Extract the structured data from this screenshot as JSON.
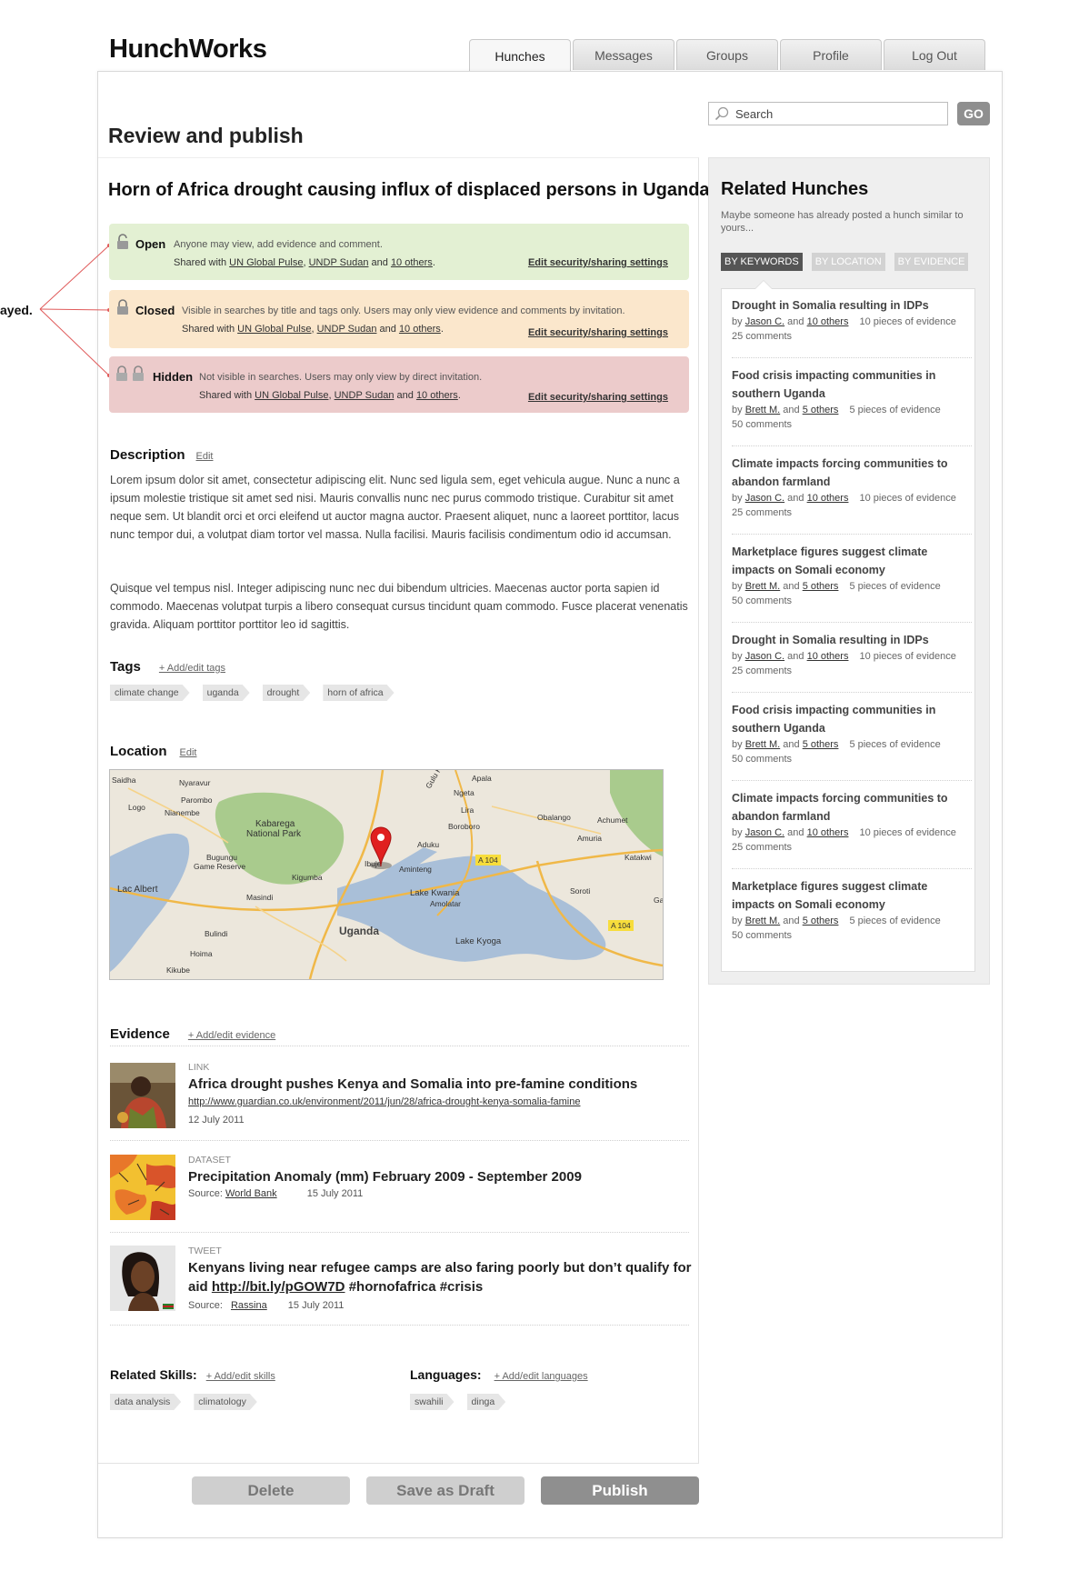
{
  "app": {
    "name": "HunchWorks"
  },
  "nav": {
    "tabs": [
      "Hunches",
      "Messages",
      "Groups",
      "Profile",
      "Log Out"
    ],
    "active": 0
  },
  "annotation": {
    "text": "ayed."
  },
  "search": {
    "placeholder": "Search",
    "go": "GO"
  },
  "page": {
    "title": "Review and publish"
  },
  "hunch": {
    "title": "Horn of Africa drought causing influx of displaced persons in Uganda",
    "security": [
      {
        "title": "Open",
        "desc": "Anyone may view, add evidence and comment.",
        "shared_prefix": "Shared with",
        "p1": "UN Global Pulse",
        "p2": "UNDP Sudan",
        "and": "and",
        "others": "10 others",
        "end": ".",
        "edit": "Edit security/sharing settings"
      },
      {
        "title": "Closed",
        "desc": "Visible in searches by title and tags only. Users may only view evidence and comments by invitation.",
        "shared_prefix": "Shared with",
        "p1": "UN Global Pulse",
        "p2": "UNDP Sudan",
        "and": "and",
        "others": "10 others",
        "end": ".",
        "edit": "Edit security/sharing settings"
      },
      {
        "title": "Hidden",
        "desc": "Not visible in searches. Users may only view by direct invitation.",
        "shared_prefix": "Shared with",
        "p1": "UN Global Pulse",
        "p2": "UNDP Sudan",
        "and": "and",
        "others": "10 others",
        "end": ".",
        "edit": "Edit security/sharing settings"
      }
    ],
    "description": {
      "heading": "Description",
      "edit": "Edit",
      "p1": "Lorem ipsum dolor sit amet, consectetur adipiscing elit. Nunc sed ligula sem, eget vehicula augue. Nunc a nunc a ipsum molestie tristique sit amet sed nisi. Mauris convallis nunc nec purus commodo tristique. Curabitur sit amet neque sem. Ut blandit orci et orci eleifend ut auctor magna auctor. Praesent aliquet, nunc a laoreet porttitor, lacus nunc tempor dui, a volutpat diam tortor vel massa. Nulla facilisi. Mauris facilisis condimentum odio id accumsan.",
      "p2": "Quisque vel tempus nisl. Integer adipiscing nunc nec dui bibendum ultricies. Maecenas auctor porta sapien id commodo. Maecenas volutpat turpis a libero consequat cursus tincidunt quam commodo. Fusce placerat venenatis gravida. Aliquam porttitor porttitor leo id sagittis."
    },
    "tags": {
      "heading": "Tags",
      "edit": "+ Add/edit tags",
      "items": [
        "climate change",
        "uganda",
        "drought",
        "horn of africa"
      ]
    },
    "location": {
      "heading": "Location",
      "edit": "Edit",
      "labels": [
        "Saidha",
        "Nyaravur",
        "Parombo",
        "Logo",
        "Nianembe",
        "Kabarega",
        "National Park",
        "Bugungu",
        "Game Reserve",
        "Lac Albert",
        "Masindi",
        "Bulindi",
        "Hoima",
        "Kikube",
        "Kigumba",
        "Uganda",
        "Ibuje",
        "Aduku",
        "Aminteng",
        "Lake Kwania",
        "Amolatar",
        "Lake Kyoga",
        "Apala",
        "Ngeta",
        "Lira",
        "Boroboro",
        "Obalango",
        "Achumet",
        "Amuria",
        "Katakwi",
        "Soroti",
        "Ga",
        "A 104",
        "A 104",
        "Gulu Rd"
      ]
    },
    "evidence": {
      "heading": "Evidence",
      "edit": "+ Add/edit evidence",
      "items": [
        {
          "type": "LINK",
          "title": "Africa drought pushes Kenya and Somalia into pre-famine conditions",
          "url": "http://www.guardian.co.uk/environment/2011/jun/28/africa-drought-kenya-somalia-famine",
          "date": "12 July 2011"
        },
        {
          "type": "DATASET",
          "title": "Precipitation Anomaly (mm) February 2009 - September 2009",
          "source_label": "Source:",
          "source": "World Bank",
          "date": "15 July 2011"
        },
        {
          "type": "TWEET",
          "title_a": "Kenyans living near refugee camps are also faring poorly but don’t qualify for",
          "title_b": "aid",
          "link": "http://bit.ly/pGOW7D",
          "title_c": "#hornofafrica #crisis",
          "source_label": "Source:",
          "source": "Rassina",
          "date": "15 July 2011"
        }
      ]
    },
    "skills": {
      "heading": "Related Skills:",
      "edit": "+ Add/edit skills",
      "items": [
        "data analysis",
        "climatology"
      ]
    },
    "languages": {
      "heading": "Languages:",
      "edit": "+ Add/edit languages",
      "items": [
        "swahili",
        "dinga"
      ]
    }
  },
  "actions": {
    "delete": "Delete",
    "draft": "Save as Draft",
    "publish": "Publish"
  },
  "related": {
    "title": "Related Hunches",
    "subtitle": "Maybe someone has already posted a hunch similar to yours...",
    "tabs": [
      "BY KEYWORDS",
      "BY LOCATION",
      "BY EVIDENCE"
    ],
    "items": [
      {
        "title": "Drought in Somalia resulting in IDPs",
        "by": "by",
        "author": "Jason C.",
        "and": "and",
        "others": "10 others",
        "evidence": "10 pieces of evidence",
        "comments": "25 comments"
      },
      {
        "title": "Food crisis impacting communities in southern Uganda",
        "by": "by",
        "author": "Brett M.",
        "and": "and",
        "others": "5 others",
        "evidence": "5 pieces of evidence",
        "comments": "50 comments"
      },
      {
        "title": "Climate impacts forcing communities to abandon farmland",
        "by": "by",
        "author": "Jason C.",
        "and": "and",
        "others": "10 others",
        "evidence": "10 pieces of evidence",
        "comments": "25 comments"
      },
      {
        "title": "Marketplace figures suggest climate impacts on Somali economy",
        "by": "by",
        "author": "Brett M.",
        "and": "and",
        "others": "5 others",
        "evidence": "5 pieces of evidence",
        "comments": "50 comments"
      },
      {
        "title": "Drought in Somalia resulting in IDPs",
        "by": "by",
        "author": "Jason C.",
        "and": "and",
        "others": "10 others",
        "evidence": "10 pieces of evidence",
        "comments": "25 comments"
      },
      {
        "title": "Food crisis impacting communities in southern Uganda",
        "by": "by",
        "author": "Brett M.",
        "and": "and",
        "others": "5 others",
        "evidence": "5 pieces of evidence",
        "comments": "50 comments"
      },
      {
        "title": "Climate impacts forcing communities to abandon farmland",
        "by": "by",
        "author": "Jason C.",
        "and": "and",
        "others": "10 others",
        "evidence": "10 pieces of evidence",
        "comments": "25 comments"
      },
      {
        "title": "Marketplace figures suggest climate impacts on Somali economy",
        "by": "by",
        "author": "Brett M.",
        "and": "and",
        "others": "5 others",
        "evidence": "5 pieces of evidence",
        "comments": "50 comments"
      }
    ]
  },
  "colors": {
    "open": "#e3f0d3",
    "closed": "#fbe7cc",
    "hidden": "#eccbcb",
    "annotation": "#e05a5a"
  }
}
